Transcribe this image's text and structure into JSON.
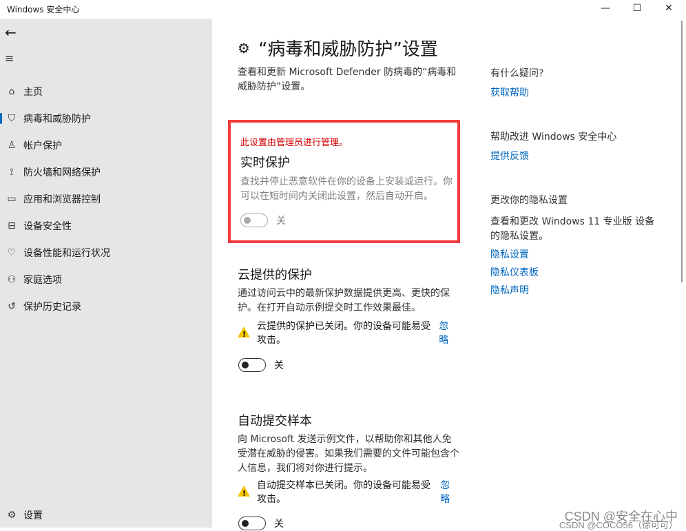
{
  "window": {
    "title": "Windows 安全中心",
    "minimize": "—",
    "maximize": "☐",
    "close": "✕"
  },
  "sidebar": {
    "back": "←",
    "menu": "≡",
    "items": [
      {
        "label": "主页",
        "icon": "⌂"
      },
      {
        "label": "病毒和威胁防护",
        "icon": "⛉"
      },
      {
        "label": "帐户保护",
        "icon": "♙"
      },
      {
        "label": "防火墙和网络保护",
        "icon": "⟟"
      },
      {
        "label": "应用和浏览器控制",
        "icon": "▭"
      },
      {
        "label": "设备安全性",
        "icon": "⊟"
      },
      {
        "label": "设备性能和运行状况",
        "icon": "♡"
      },
      {
        "label": "家庭选项",
        "icon": "⚇"
      },
      {
        "label": "保护历史记录",
        "icon": "↺"
      }
    ],
    "settings": {
      "label": "设置",
      "icon": "⚙"
    }
  },
  "main": {
    "icon": "⚙",
    "title": "“病毒和威胁防护”设置",
    "description": "查看和更新 Microsoft Defender 防病毒的“病毒和威胁防护”设置。",
    "realtime": {
      "admin_notice": "此设置由管理员进行管理。",
      "title": "实时保护",
      "description": "查找并停止恶意软件在你的设备上安装或运行。你可以在短时间内关闭此设置，然后自动开启。",
      "state": "关"
    },
    "cloud": {
      "title": "云提供的保护",
      "description": "通过访问云中的最新保护数据提供更高、更快的保护。在打开自动示例提交时工作效果最佳。",
      "warning": "云提供的保护已关闭。你的设备可能易受攻击。",
      "dismiss": "忽略",
      "state": "关"
    },
    "sample": {
      "title": "自动提交样本",
      "description": "向 Microsoft 发送示例文件，以帮助你和其他人免受潜在威胁的侵害。如果我们需要的文件可能包含个人信息，我们将对你进行提示。",
      "warning": "自动提交样本已关闭。你的设备可能易受攻击。",
      "dismiss": "忽略",
      "state": "关"
    }
  },
  "right": {
    "question": "有什么疑问?",
    "get_help": "获取帮助",
    "improve": "帮助改进 Windows 安全中心",
    "feedback": "提供反馈",
    "privacy_title": "更改你的隐私设置",
    "privacy_desc": "查看和更改 Windows 11 专业版 设备的隐私设置。",
    "links": [
      "隐私设置",
      "隐私仪表板",
      "隐私声明"
    ]
  },
  "watermark": {
    "line1": "CSDN @安全在心中",
    "line2": "CSDN @COCO56（徐可可）"
  }
}
